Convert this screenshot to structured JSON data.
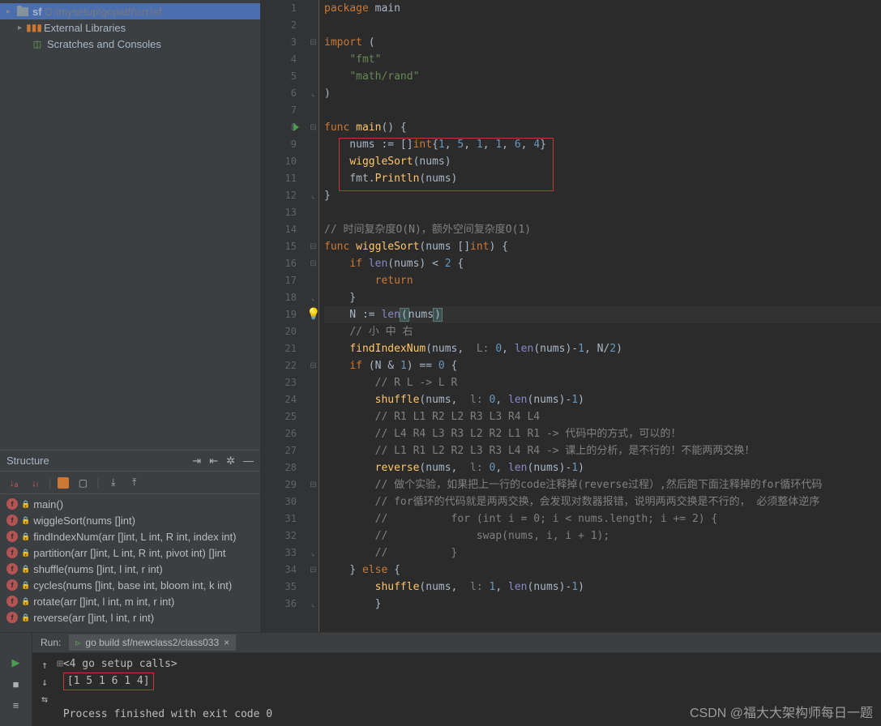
{
  "project": {
    "root_name": "sf",
    "root_path": "D:\\mysetup\\gopath\\src\\sf",
    "ext_lib": "External Libraries",
    "scratches": "Scratches and Consoles"
  },
  "structure": {
    "title": "Structure",
    "items": [
      "main()",
      "wiggleSort(nums []int)",
      "findIndexNum(arr []int, L int, R int, index int)",
      "partition(arr []int, L int, R int, pivot int) []int",
      "shuffle(nums []int, l int, r int)",
      "cycles(nums []int, base int, bloom int, k int)",
      "rotate(arr []int, l int, m int, r int)",
      "reverse(arr []int, l int, r int)"
    ]
  },
  "editor": {
    "lines": [
      {
        "n": 1,
        "f": " ",
        "html": "<span class='kw'>package</span> <span class='ident'>main</span>"
      },
      {
        "n": 2,
        "f": " ",
        "html": ""
      },
      {
        "n": 3,
        "f": "⊟",
        "html": "<span class='kw'>import</span> ("
      },
      {
        "n": 4,
        "f": " ",
        "html": "    <span class='str'>\"fmt\"</span>"
      },
      {
        "n": 5,
        "f": " ",
        "html": "    <span class='str'>\"math/rand\"</span>"
      },
      {
        "n": 6,
        "f": "⌞",
        "html": ")"
      },
      {
        "n": 7,
        "f": " ",
        "html": ""
      },
      {
        "n": 8,
        "f": "⊟",
        "run": true,
        "html": "<span class='kw'>func</span> <span class='fn'>main</span>() {"
      },
      {
        "n": 9,
        "f": " ",
        "html": "    nums := []<span class='kw'>int</span>{<span class='num'>1</span>, <span class='num'>5</span>, <span class='num'>1</span>, <span class='num'>1</span>, <span class='num'>6</span>, <span class='num'>4</span>}"
      },
      {
        "n": 10,
        "f": " ",
        "html": "    <span class='fn'>wiggleSort</span>(nums)"
      },
      {
        "n": 11,
        "f": " ",
        "html": "    fmt.<span class='fn'>Println</span>(nums)"
      },
      {
        "n": 12,
        "f": "⌞",
        "html": "}"
      },
      {
        "n": 13,
        "f": " ",
        "html": ""
      },
      {
        "n": 14,
        "f": " ",
        "html": "<span class='cmt'>// 时间复杂度O(N)，额外空间复杂度O(1)</span>"
      },
      {
        "n": 15,
        "f": "⊟",
        "html": "<span class='kw'>func</span> <span class='fn'>wiggleSort</span>(nums []<span class='kw'>int</span>) {"
      },
      {
        "n": 16,
        "f": "⊟",
        "html": "    <span class='kw'>if</span> <span class='builtin'>len</span>(nums) &lt; <span class='num'>2</span> {"
      },
      {
        "n": 17,
        "f": " ",
        "html": "        <span class='kw'>return</span>"
      },
      {
        "n": 18,
        "f": "⌞",
        "html": "    }"
      },
      {
        "n": 19,
        "f": " ",
        "cur": true,
        "bulb": true,
        "html": "    N := <span class='builtin'>len</span><span class='sel-paren'>(</span>nums<span class='sel-paren'>)</span>"
      },
      {
        "n": 20,
        "f": " ",
        "html": "    <span class='cmt'>// 小 中 右</span>"
      },
      {
        "n": 21,
        "f": " ",
        "html": "    <span class='fn'>findIndexNum</span>(nums,  <span class='cmt'>L:</span> <span class='num'>0</span>, <span class='builtin'>len</span>(nums)-<span class='num'>1</span>, N/<span class='num'>2</span>)"
      },
      {
        "n": 22,
        "f": "⊟",
        "html": "    <span class='kw'>if</span> (N &amp; <span class='num'>1</span>) == <span class='num'>0</span> {"
      },
      {
        "n": 23,
        "f": " ",
        "html": "        <span class='cmt'>// R L -&gt; L R</span>"
      },
      {
        "n": 24,
        "f": " ",
        "html": "        <span class='fn'>shuffle</span>(nums,  <span class='cmt'>l:</span> <span class='num'>0</span>, <span class='builtin'>len</span>(nums)-<span class='num'>1</span>)"
      },
      {
        "n": 25,
        "f": " ",
        "html": "        <span class='cmt'>// R1 L1 R2 L2 R3 L3 R4 L4</span>"
      },
      {
        "n": 26,
        "f": " ",
        "html": "        <span class='cmt'>// L4 R4 L3 R3 L2 R2 L1 R1 -&gt; 代码中的方式，可以的！</span>"
      },
      {
        "n": 27,
        "f": " ",
        "html": "        <span class='cmt'>// L1 R1 L2 R2 L3 R3 L4 R4 -&gt; 课上的分析，是不行的！不能两两交换！</span>"
      },
      {
        "n": 28,
        "f": " ",
        "html": "        <span class='fn'>reverse</span>(nums,  <span class='cmt'>l:</span> <span class='num'>0</span>, <span class='builtin'>len</span>(nums)-<span class='num'>1</span>)"
      },
      {
        "n": 29,
        "f": "⊟",
        "html": "        <span class='cmt'>// 做个实验，如果把上一行的code注释掉(reverse过程）,然后跑下面注释掉的for循环代码</span>"
      },
      {
        "n": 30,
        "f": " ",
        "html": "        <span class='cmt'>// for循环的代码就是两两交换，会发现对数器报错，说明两两交换是不行的， 必须整体逆序</span>"
      },
      {
        "n": 31,
        "f": " ",
        "html": "        <span class='cmt'>//          for (int i = 0; i &lt; nums.length; i += 2) {</span>"
      },
      {
        "n": 32,
        "f": " ",
        "html": "        <span class='cmt'>//              swap(nums, i, i + 1);</span>"
      },
      {
        "n": 33,
        "f": "⌞",
        "html": "        <span class='cmt'>//          }</span>"
      },
      {
        "n": 34,
        "f": "⊟",
        "html": "    } <span class='kw'>else</span> {"
      },
      {
        "n": 35,
        "f": " ",
        "html": "        <span class='fn'>shuffle</span>(nums,  <span class='cmt'>l:</span> <span class='num'>1</span>, <span class='builtin'>len</span>(nums)-<span class='num'>1</span>)"
      },
      {
        "n": 36,
        "f": "⌞",
        "html": "        }"
      }
    ],
    "breadcrumb": "wiggleSort(nums []int)"
  },
  "run": {
    "label": "Run:",
    "tab": "go build sf/newclass2/class033",
    "console": {
      "setup": "<4 go setup calls>",
      "output": "[1 5 1 6 1 4]",
      "finished": "Process finished with exit code 0"
    }
  },
  "watermark": "CSDN @福大大架构师每日一题"
}
